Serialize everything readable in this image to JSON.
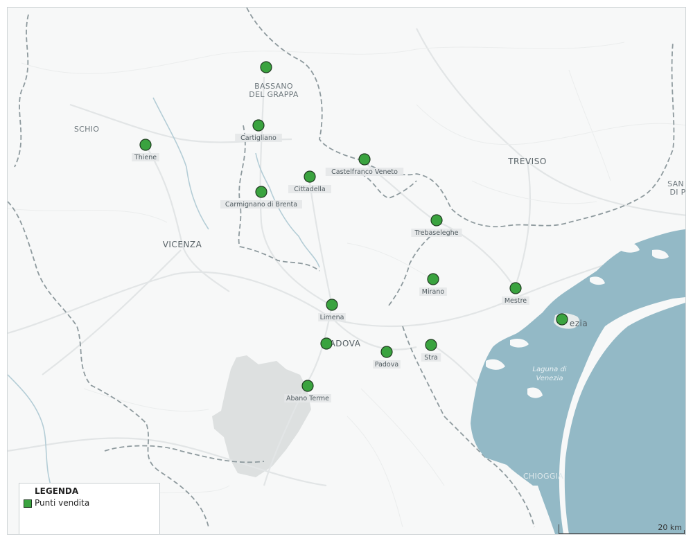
{
  "legend": {
    "title": "LEGENDA",
    "item_label": "Punti vendita",
    "item_color": "#3aa33f"
  },
  "scale": {
    "label": "20 km"
  },
  "colors": {
    "land": "#f7f8f8",
    "water": "#93b9c6",
    "park": "#dde0e0",
    "marker": "#3aa33f",
    "border": "#8e9a9e"
  },
  "city_labels": {
    "bassano_line1": "BASSANO",
    "bassano_line2": "DEL GRAPPA",
    "schio": "SCHIO",
    "vicenza": "VICENZA",
    "treviso": "TREVISO",
    "padova_big": "ADOVA",
    "venezia": "ezia",
    "chioggia": "CHIOGGIA",
    "san_line1": "SAN",
    "san_line2": "DI P",
    "laguna_line1": "Laguna di",
    "laguna_line2": "Venezia"
  },
  "points": [
    {
      "name": "Bassano del Grappa",
      "label": ""
    },
    {
      "name": "Cartigliano",
      "label": "Cartigliano"
    },
    {
      "name": "Thiene",
      "label": "Thiene"
    },
    {
      "name": "Castelfranco Veneto",
      "label": "Castelfranco Veneto"
    },
    {
      "name": "Cittadella",
      "label": "Cittadella"
    },
    {
      "name": "Carmignano di Brenta",
      "label": "Carmignano di Brenta"
    },
    {
      "name": "Trebaseleghe",
      "label": "Trebaseleghe"
    },
    {
      "name": "Mirano",
      "label": "Mirano"
    },
    {
      "name": "Mestre",
      "label": "Mestre"
    },
    {
      "name": "Venezia",
      "label": ""
    },
    {
      "name": "Limena",
      "label": "Limena"
    },
    {
      "name": "Padova Nord",
      "label": ""
    },
    {
      "name": "Padova",
      "label": "Padova"
    },
    {
      "name": "Stra",
      "label": "Stra"
    },
    {
      "name": "Abano Terme",
      "label": "Abano Terme"
    }
  ]
}
